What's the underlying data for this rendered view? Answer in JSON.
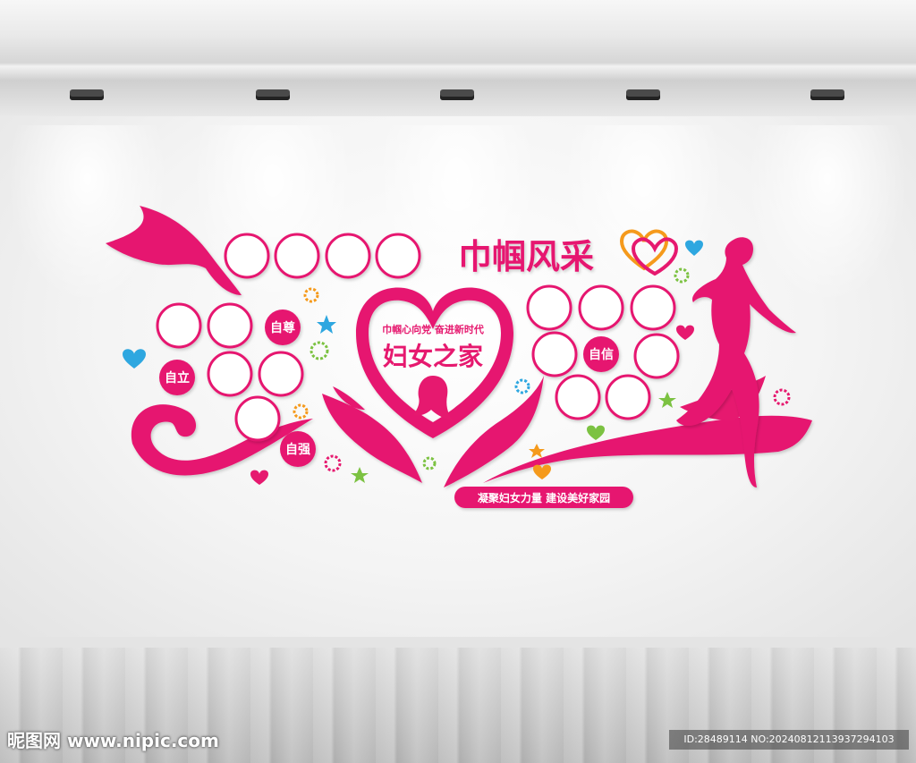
{
  "title": "巾帼风采",
  "heart": {
    "subtitle": "巾帼心向党 奋进新时代",
    "name": "妇女之家"
  },
  "virtues": [
    "自尊",
    "自立",
    "自强",
    "自信"
  ],
  "slogan": "凝聚妇女力量 建设美好家园",
  "watermark": {
    "site": "昵图网 www.nipic.com",
    "id": "ID:28489114 NO:20240812113937294103"
  },
  "colors": {
    "accent": "#e6196f",
    "wall": "#f5f5f5"
  }
}
